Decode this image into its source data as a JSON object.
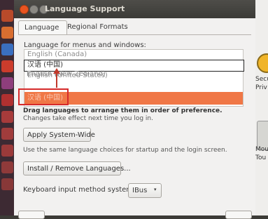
{
  "window": {
    "title": "Language Support"
  },
  "tabs": [
    {
      "label": "Language"
    },
    {
      "label": "Regional Formats"
    }
  ],
  "language_section": {
    "label": "Language for menus and windows:",
    "rows": [
      "English (Canada)",
      "汉语 (中国)",
      "English (New Zealand)",
      "English (United States)",
      "汉语 (中国)"
    ]
  },
  "hints": {
    "bold": "Drag languages to arrange them in order of preference.",
    "normal": "Changes take effect next time you log in."
  },
  "buttons": {
    "apply": "Apply System-Wide",
    "install": "Install / Remove Languages..."
  },
  "apply_description": "Use the same language choices for startup and the login screen.",
  "keyboard": {
    "label": "Keyboard input method system:",
    "value": "IBus",
    "arrow": "▾"
  },
  "background_window": {
    "label1": "Secur",
    "label2": "Priv",
    "label3": "Mou",
    "label4": "Tou"
  },
  "colors": {
    "selection": "#f07746",
    "annotation_red": "#d62b2b",
    "titlebar": "#3c3b37"
  }
}
